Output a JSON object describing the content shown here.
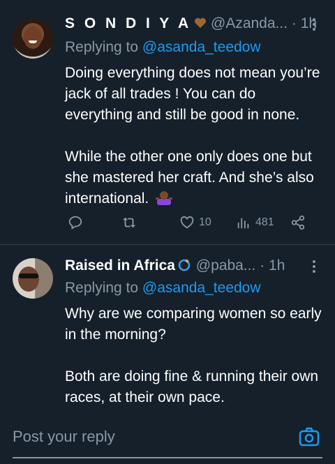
{
  "colors": {
    "background": "#15202b",
    "accent": "#1d9bf0",
    "muted": "#8b98a5",
    "divider": "#38444d"
  },
  "tweets": [
    {
      "name": "S O N D I Y A",
      "name_emoji": "brown-heart-icon",
      "handle": "@Azanda...",
      "dot": "·",
      "time": "1h",
      "replying_prefix": "Replying to",
      "replying_to": "@asanda_teedow",
      "paragraphs": [
        "Doing everything does not mean you’re jack of all trades ! You can do everything and still be good in none.",
        "While the other one only does one but she mastered her craft. And she’s also international."
      ],
      "actions": {
        "reply_count": "",
        "retweet_count": "",
        "like_count": "10",
        "views_count": "481"
      }
    },
    {
      "name": "Raised in Africa",
      "name_emoji": "dizzy-icon",
      "handle": "@paba...",
      "dot": "·",
      "time": "1h",
      "replying_prefix": "Replying to",
      "replying_to": "@asanda_teedow",
      "paragraphs": [
        "Why are we comparing women so early in the morning?",
        "Both are doing fine & running their own races, at their own pace."
      ]
    }
  ],
  "reply_bar": {
    "placeholder": "Post your reply"
  }
}
